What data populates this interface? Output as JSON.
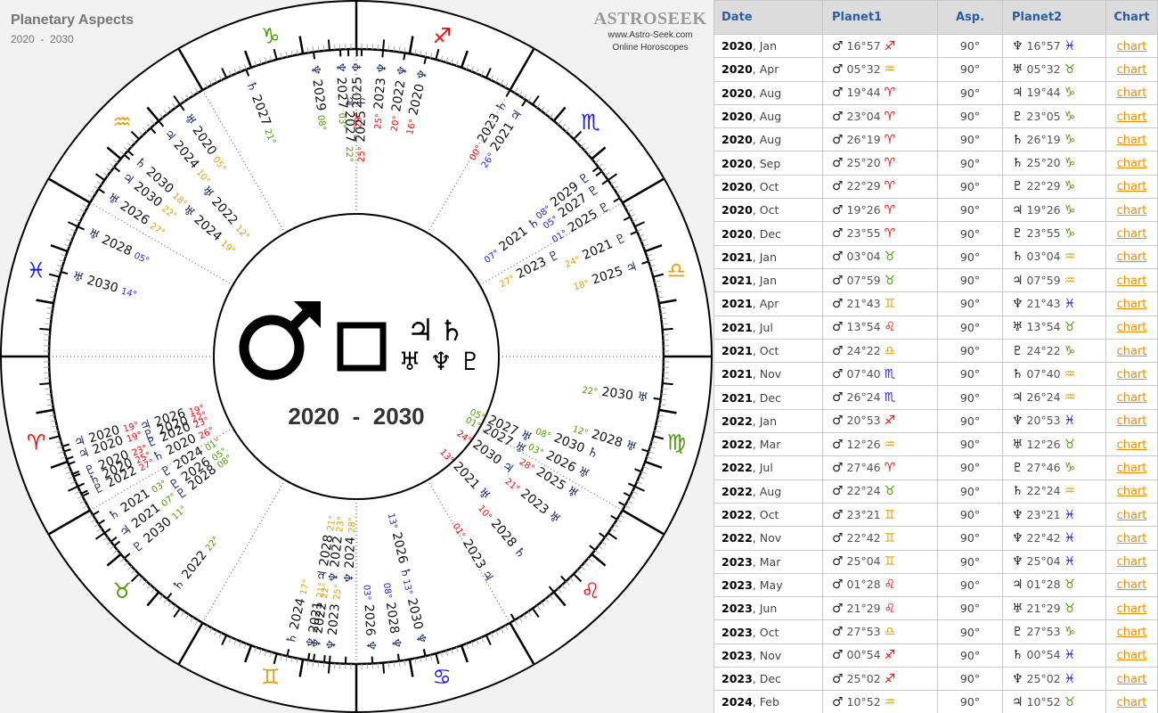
{
  "header": {
    "title": "Planetary Aspects",
    "subtitle": "2020  -  2030"
  },
  "logo": {
    "name": "ASTROSEEK",
    "url": "www.Astro-Seek.com",
    "tagline": "Online Horoscopes"
  },
  "wheel": {
    "center": {
      "planet1_icon": "mars-icon",
      "planet1_glyph": "♂",
      "aspect_icon": "square-aspect-icon",
      "aspect_glyph": "□",
      "planets2": [
        {
          "icon": "jupiter-icon",
          "glyph": "♃"
        },
        {
          "icon": "saturn-icon",
          "glyph": "♄"
        },
        {
          "icon": "uranus-icon",
          "glyph": "♅"
        },
        {
          "icon": "neptune-icon",
          "glyph": "♆"
        },
        {
          "icon": "pluto-icon",
          "glyph": "♇"
        }
      ],
      "years": "2020  -  2030"
    },
    "signs": [
      {
        "name": "Aries",
        "icon": "aries-icon",
        "glyph": "♈",
        "color": "#ff0000"
      },
      {
        "name": "Taurus",
        "icon": "taurus-icon",
        "glyph": "♉",
        "color": "#4c9a00"
      },
      {
        "name": "Gemini",
        "icon": "gemini-icon",
        "glyph": "♊",
        "color": "#e0a000"
      },
      {
        "name": "Cancer",
        "icon": "cancer-icon",
        "glyph": "♋",
        "color": "#1a1aff"
      },
      {
        "name": "Leo",
        "icon": "leo-icon",
        "glyph": "♌",
        "color": "#ff0000"
      },
      {
        "name": "Virgo",
        "icon": "virgo-icon",
        "glyph": "♍",
        "color": "#4c9a00"
      },
      {
        "name": "Libra",
        "icon": "libra-icon",
        "glyph": "♎",
        "color": "#e0a000"
      },
      {
        "name": "Scorpio",
        "icon": "scorpio-icon",
        "glyph": "♏",
        "color": "#1a1aff"
      },
      {
        "name": "Sagittarius",
        "icon": "sagittarius-icon",
        "glyph": "♐",
        "color": "#ff0000"
      },
      {
        "name": "Capricorn",
        "icon": "capricorn-icon",
        "glyph": "♑",
        "color": "#4c9a00"
      },
      {
        "name": "Aquarius",
        "icon": "aquarius-icon",
        "glyph": "♒",
        "color": "#e0a000"
      },
      {
        "name": "Pisces",
        "icon": "pisces-icon",
        "glyph": "♓",
        "color": "#1a1aff"
      }
    ],
    "markers": [
      {
        "planet": "♆",
        "year": "2020",
        "deg": "16°",
        "lon": 256.9,
        "row": 0
      },
      {
        "planet": "♆",
        "year": "2022",
        "deg": "20°",
        "lon": 260.9,
        "row": 0
      },
      {
        "planet": "♆",
        "year": "2023",
        "deg": "25°",
        "lon": 265.0,
        "row": 0
      },
      {
        "planet": "♆",
        "year": "2025",
        "deg": "29°",
        "lon": 269.9,
        "row": 0
      },
      {
        "planet": "♆",
        "year": "2027",
        "deg": "03°",
        "lon": 273.0,
        "row": 0
      },
      {
        "planet": "♆",
        "year": "2029",
        "deg": "08°",
        "lon": 278.0,
        "row": 0
      },
      {
        "planet": "♄",
        "year": "2027",
        "deg": "21°",
        "lon": 291.0,
        "row": 0
      },
      {
        "planet": "♄",
        "year": "2025",
        "deg": "25°",
        "lon": 269.0,
        "row": 1
      },
      {
        "planet": "♃",
        "year": "2027",
        "deg": "22°",
        "lon": 271.5,
        "row": 1
      },
      {
        "planet": "♄",
        "year": "2023",
        "deg": "00°",
        "lon": 240.0,
        "row": 0
      },
      {
        "planet": "♃",
        "year": "2021",
        "deg": "26°",
        "lon": 236.5,
        "row": 0
      },
      {
        "planet": "♇",
        "year": "2029",
        "deg": "08°",
        "lon": 218.0,
        "row": 0
      },
      {
        "planet": "♇",
        "year": "2027",
        "deg": "05°",
        "lon": 215.0,
        "row": 0
      },
      {
        "planet": "♇",
        "year": "2025",
        "deg": "01°",
        "lon": 211.0,
        "row": 0
      },
      {
        "planet": "♄",
        "year": "2021",
        "deg": "07°",
        "lon": 217.0,
        "row": 2
      },
      {
        "planet": "♇",
        "year": "2023",
        "deg": "27°",
        "lon": 207.0,
        "row": 2
      },
      {
        "planet": "♇",
        "year": "2021",
        "deg": "24°",
        "lon": 204.0,
        "row": 0
      },
      {
        "planet": "♃",
        "year": "2025",
        "deg": "18°",
        "lon": 198.0,
        "row": 0
      },
      {
        "planet": "♅",
        "year": "2030",
        "deg": "22°",
        "lon": 172.0,
        "row": 0
      },
      {
        "planet": "♅",
        "year": "2028",
        "deg": "12°",
        "lon": 162.0,
        "row": 0
      },
      {
        "planet": "♄",
        "year": "2030",
        "deg": "08°",
        "lon": 158.0,
        "row": 1
      },
      {
        "planet": "♅",
        "year": "2026",
        "deg": "03°",
        "lon": 153.0,
        "row": 1
      },
      {
        "planet": "♅",
        "year": "2025",
        "deg": "28°",
        "lon": 148.0,
        "row": 1
      },
      {
        "planet": "♅",
        "year": "2027",
        "deg": "05°",
        "lon": 155.0,
        "row": 3
      },
      {
        "planet": "♅",
        "year": "2027",
        "deg": "01°",
        "lon": 151.0,
        "row": 3
      },
      {
        "planet": "♃",
        "year": "2030",
        "deg": "24°",
        "lon": 144.0,
        "row": 3
      },
      {
        "planet": "♅",
        "year": "2023",
        "deg": "21°",
        "lon": 141.0,
        "row": 1
      },
      {
        "planet": "♅",
        "year": "2021",
        "deg": "13°",
        "lon": 133.0,
        "row": 3
      },
      {
        "planet": "♄",
        "year": "2028",
        "deg": "10°",
        "lon": 130.0,
        "row": 1
      },
      {
        "planet": "♃",
        "year": "2023",
        "deg": "01°",
        "lon": 121.0,
        "row": 1
      },
      {
        "planet": "♆",
        "year": "2030",
        "deg": "13°",
        "lon": 103.0,
        "row": 0
      },
      {
        "planet": "♆",
        "year": "2028",
        "deg": "08°",
        "lon": 98.0,
        "row": 0
      },
      {
        "planet": "♆",
        "year": "2026",
        "deg": "03°",
        "lon": 93.0,
        "row": 0
      },
      {
        "planet": "♄",
        "year": "2026",
        "deg": "13°",
        "lon": 103.0,
        "row": 2
      },
      {
        "planet": "♆",
        "year": "2023",
        "deg": "25°",
        "lon": 85.0,
        "row": 0
      },
      {
        "planet": "♆",
        "year": "2022",
        "deg": "22°",
        "lon": 82.0,
        "row": 0
      },
      {
        "planet": "♆",
        "year": "2021",
        "deg": "21°",
        "lon": 81.0,
        "row": 0
      },
      {
        "planet": "♄",
        "year": "2024",
        "deg": "17°",
        "lon": 77.0,
        "row": 0
      },
      {
        "planet": "♆",
        "year": "2024",
        "deg": "28°",
        "lon": 88.0,
        "row": 2
      },
      {
        "planet": "♆",
        "year": "2022",
        "deg": "23°",
        "lon": 84.0,
        "row": 2
      },
      {
        "planet": "♃",
        "year": "2028",
        "deg": "21°",
        "lon": 81.0,
        "row": 2
      },
      {
        "planet": "♄",
        "year": "2022",
        "deg": "22°",
        "lon": 52.0,
        "row": 0
      },
      {
        "planet": "♇",
        "year": "2030",
        "deg": "11°",
        "lon": 41.0,
        "row": 0
      },
      {
        "planet": "♃",
        "year": "2021",
        "deg": "07°",
        "lon": 37.0,
        "row": 0
      },
      {
        "planet": "♄",
        "year": "2021",
        "deg": "03°",
        "lon": 33.0,
        "row": 0
      },
      {
        "planet": "♇",
        "year": "2022",
        "deg": "27°",
        "lon": 27.0,
        "row": 0
      },
      {
        "planet": "♄",
        "year": "2020",
        "deg": "25°",
        "lon": 25.0,
        "row": 0
      },
      {
        "planet": "♇",
        "year": "2020",
        "deg": "23°",
        "lon": 23.0,
        "row": 0
      },
      {
        "planet": "♃",
        "year": "2020",
        "deg": "19°",
        "lon": 19.5,
        "row": 0
      },
      {
        "planet": "♃",
        "year": "2020",
        "deg": "19°",
        "lon": 17.0,
        "row": 0
      },
      {
        "planet": "♇",
        "year": "2028",
        "deg": "08°",
        "lon": 38.0,
        "row": 2
      },
      {
        "planet": "♇",
        "year": "2026",
        "deg": "05°",
        "lon": 35.0,
        "row": 2
      },
      {
        "planet": "♇",
        "year": "2024",
        "deg": "01°",
        "lon": 31.0,
        "row": 2
      },
      {
        "planet": "♄",
        "year": "2020",
        "deg": "26°",
        "lon": 26.5,
        "row": 2
      },
      {
        "planet": "♇",
        "year": "2020",
        "deg": "23°",
        "lon": 22.5,
        "row": 2
      },
      {
        "planet": "♇",
        "year": "2020",
        "deg": "22°",
        "lon": 20.5,
        "row": 2
      },
      {
        "planet": "♃",
        "year": "2026",
        "deg": "19°",
        "lon": 18.0,
        "row": 2
      },
      {
        "planet": "♅",
        "year": "2030",
        "deg": "14°",
        "lon": 344.0,
        "row": 0
      },
      {
        "planet": "♅",
        "year": "2028",
        "deg": "05°",
        "lon": 335.0,
        "row": 0
      },
      {
        "planet": "♅",
        "year": "2026",
        "deg": "27°",
        "lon": 327.0,
        "row": 0
      },
      {
        "planet": "♃",
        "year": "2030",
        "deg": "22°",
        "lon": 322.0,
        "row": 0
      },
      {
        "planet": "♄",
        "year": "2030",
        "deg": "18°",
        "lon": 318.0,
        "row": 0
      },
      {
        "planet": "♃",
        "year": "2024",
        "deg": "10°",
        "lon": 310.0,
        "row": 0
      },
      {
        "planet": "♅",
        "year": "2020",
        "deg": "05°",
        "lon": 305.0,
        "row": 0
      },
      {
        "planet": "♅",
        "year": "2024",
        "deg": "19°",
        "lon": 319.0,
        "row": 2
      },
      {
        "planet": "♅",
        "year": "2022",
        "deg": "12°",
        "lon": 312.0,
        "row": 2
      }
    ]
  },
  "table": {
    "columns": [
      "Date",
      "Planet1",
      "Asp.",
      "Planet2",
      "Chart"
    ],
    "rows": [
      {
        "year": "2020",
        "month": ", Jan",
        "p1": "♂",
        "p1_deg": "16°57",
        "p1_sign": "♐",
        "p1_color": "#ff0000",
        "asp": "90°",
        "p2": "♆",
        "p2_deg": "16°57",
        "p2_sign": "♓",
        "p2_color": "#1a1aff",
        "link": "chart"
      },
      {
        "year": "2020",
        "month": ", Apr",
        "p1": "♂",
        "p1_deg": "05°32",
        "p1_sign": "♒",
        "p1_color": "#e0a000",
        "asp": "90°",
        "p2": "♅",
        "p2_deg": "05°32",
        "p2_sign": "♉",
        "p2_color": "#4c9a00",
        "link": "chart"
      },
      {
        "year": "2020",
        "month": ", Aug",
        "p1": "♂",
        "p1_deg": "19°44",
        "p1_sign": "♈",
        "p1_color": "#ff0000",
        "asp": "90°",
        "p2": "♃",
        "p2_deg": "19°44",
        "p2_sign": "♑",
        "p2_color": "#4c9a00",
        "link": "chart"
      },
      {
        "year": "2020",
        "month": ", Aug",
        "p1": "♂",
        "p1_deg": "23°04",
        "p1_sign": "♈",
        "p1_color": "#ff0000",
        "asp": "90°",
        "p2": "♇",
        "p2_deg": "23°05",
        "p2_sign": "♑",
        "p2_color": "#4c9a00",
        "link": "chart"
      },
      {
        "year": "2020",
        "month": ", Aug",
        "p1": "♂",
        "p1_deg": "26°19",
        "p1_sign": "♈",
        "p1_color": "#ff0000",
        "asp": "90°",
        "p2": "♄",
        "p2_deg": "26°19",
        "p2_sign": "♑",
        "p2_color": "#4c9a00",
        "link": "chart"
      },
      {
        "year": "2020",
        "month": ", Sep",
        "p1": "♂",
        "p1_deg": "25°20",
        "p1_sign": "♈",
        "p1_color": "#ff0000",
        "asp": "90°",
        "p2": "♄",
        "p2_deg": "25°20",
        "p2_sign": "♑",
        "p2_color": "#4c9a00",
        "link": "chart"
      },
      {
        "year": "2020",
        "month": ", Oct",
        "p1": "♂",
        "p1_deg": "22°29",
        "p1_sign": "♈",
        "p1_color": "#ff0000",
        "asp": "90°",
        "p2": "♇",
        "p2_deg": "22°29",
        "p2_sign": "♑",
        "p2_color": "#4c9a00",
        "link": "chart"
      },
      {
        "year": "2020",
        "month": ", Oct",
        "p1": "♂",
        "p1_deg": "19°26",
        "p1_sign": "♈",
        "p1_color": "#ff0000",
        "asp": "90°",
        "p2": "♃",
        "p2_deg": "19°26",
        "p2_sign": "♑",
        "p2_color": "#4c9a00",
        "link": "chart"
      },
      {
        "year": "2020",
        "month": ", Dec",
        "p1": "♂",
        "p1_deg": "23°55",
        "p1_sign": "♈",
        "p1_color": "#ff0000",
        "asp": "90°",
        "p2": "♇",
        "p2_deg": "23°55",
        "p2_sign": "♑",
        "p2_color": "#4c9a00",
        "link": "chart"
      },
      {
        "year": "2021",
        "month": ", Jan",
        "p1": "♂",
        "p1_deg": "03°04",
        "p1_sign": "♉",
        "p1_color": "#4c9a00",
        "asp": "90°",
        "p2": "♄",
        "p2_deg": "03°04",
        "p2_sign": "♒",
        "p2_color": "#e0a000",
        "link": "chart"
      },
      {
        "year": "2021",
        "month": ", Jan",
        "p1": "♂",
        "p1_deg": "07°59",
        "p1_sign": "♉",
        "p1_color": "#4c9a00",
        "asp": "90°",
        "p2": "♃",
        "p2_deg": "07°59",
        "p2_sign": "♒",
        "p2_color": "#e0a000",
        "link": "chart"
      },
      {
        "year": "2021",
        "month": ", Apr",
        "p1": "♂",
        "p1_deg": "21°43",
        "p1_sign": "♊",
        "p1_color": "#e0a000",
        "asp": "90°",
        "p2": "♆",
        "p2_deg": "21°43",
        "p2_sign": "♓",
        "p2_color": "#1a1aff",
        "link": "chart"
      },
      {
        "year": "2021",
        "month": ", Jul",
        "p1": "♂",
        "p1_deg": "13°54",
        "p1_sign": "♌",
        "p1_color": "#ff0000",
        "asp": "90°",
        "p2": "♅",
        "p2_deg": "13°54",
        "p2_sign": "♉",
        "p2_color": "#4c9a00",
        "link": "chart"
      },
      {
        "year": "2021",
        "month": ", Oct",
        "p1": "♂",
        "p1_deg": "24°22",
        "p1_sign": "♎",
        "p1_color": "#e0a000",
        "asp": "90°",
        "p2": "♇",
        "p2_deg": "24°22",
        "p2_sign": "♑",
        "p2_color": "#4c9a00",
        "link": "chart"
      },
      {
        "year": "2021",
        "month": ", Nov",
        "p1": "♂",
        "p1_deg": "07°40",
        "p1_sign": "♏",
        "p1_color": "#1a1aff",
        "asp": "90°",
        "p2": "♄",
        "p2_deg": "07°40",
        "p2_sign": "♒",
        "p2_color": "#e0a000",
        "link": "chart"
      },
      {
        "year": "2021",
        "month": ", Dec",
        "p1": "♂",
        "p1_deg": "26°24",
        "p1_sign": "♏",
        "p1_color": "#1a1aff",
        "asp": "90°",
        "p2": "♃",
        "p2_deg": "26°24",
        "p2_sign": "♒",
        "p2_color": "#e0a000",
        "link": "chart"
      },
      {
        "year": "2022",
        "month": ", Jan",
        "p1": "♂",
        "p1_deg": "20°53",
        "p1_sign": "♐",
        "p1_color": "#ff0000",
        "asp": "90°",
        "p2": "♆",
        "p2_deg": "20°53",
        "p2_sign": "♓",
        "p2_color": "#1a1aff",
        "link": "chart"
      },
      {
        "year": "2022",
        "month": ", Mar",
        "p1": "♂",
        "p1_deg": "12°26",
        "p1_sign": "♒",
        "p1_color": "#e0a000",
        "asp": "90°",
        "p2": "♅",
        "p2_deg": "12°26",
        "p2_sign": "♉",
        "p2_color": "#4c9a00",
        "link": "chart"
      },
      {
        "year": "2022",
        "month": ", Jul",
        "p1": "♂",
        "p1_deg": "27°46",
        "p1_sign": "♈",
        "p1_color": "#ff0000",
        "asp": "90°",
        "p2": "♇",
        "p2_deg": "27°46",
        "p2_sign": "♑",
        "p2_color": "#4c9a00",
        "link": "chart"
      },
      {
        "year": "2022",
        "month": ", Aug",
        "p1": "♂",
        "p1_deg": "22°24",
        "p1_sign": "♉",
        "p1_color": "#4c9a00",
        "asp": "90°",
        "p2": "♄",
        "p2_deg": "22°24",
        "p2_sign": "♒",
        "p2_color": "#e0a000",
        "link": "chart"
      },
      {
        "year": "2022",
        "month": ", Oct",
        "p1": "♂",
        "p1_deg": "23°21",
        "p1_sign": "♊",
        "p1_color": "#e0a000",
        "asp": "90°",
        "p2": "♆",
        "p2_deg": "23°21",
        "p2_sign": "♓",
        "p2_color": "#1a1aff",
        "link": "chart"
      },
      {
        "year": "2022",
        "month": ", Nov",
        "p1": "♂",
        "p1_deg": "22°42",
        "p1_sign": "♊",
        "p1_color": "#e0a000",
        "asp": "90°",
        "p2": "♆",
        "p2_deg": "22°42",
        "p2_sign": "♓",
        "p2_color": "#1a1aff",
        "link": "chart"
      },
      {
        "year": "2023",
        "month": ", Mar",
        "p1": "♂",
        "p1_deg": "25°04",
        "p1_sign": "♊",
        "p1_color": "#e0a000",
        "asp": "90°",
        "p2": "♆",
        "p2_deg": "25°04",
        "p2_sign": "♓",
        "p2_color": "#1a1aff",
        "link": "chart"
      },
      {
        "year": "2023",
        "month": ", May",
        "p1": "♂",
        "p1_deg": "01°28",
        "p1_sign": "♌",
        "p1_color": "#ff0000",
        "asp": "90°",
        "p2": "♃",
        "p2_deg": "01°28",
        "p2_sign": "♉",
        "p2_color": "#4c9a00",
        "link": "chart"
      },
      {
        "year": "2023",
        "month": ", Jun",
        "p1": "♂",
        "p1_deg": "21°29",
        "p1_sign": "♌",
        "p1_color": "#ff0000",
        "asp": "90°",
        "p2": "♅",
        "p2_deg": "21°29",
        "p2_sign": "♉",
        "p2_color": "#4c9a00",
        "link": "chart"
      },
      {
        "year": "2023",
        "month": ", Oct",
        "p1": "♂",
        "p1_deg": "27°53",
        "p1_sign": "♎",
        "p1_color": "#e0a000",
        "asp": "90°",
        "p2": "♇",
        "p2_deg": "27°53",
        "p2_sign": "♑",
        "p2_color": "#4c9a00",
        "link": "chart"
      },
      {
        "year": "2023",
        "month": ", Nov",
        "p1": "♂",
        "p1_deg": "00°54",
        "p1_sign": "♐",
        "p1_color": "#ff0000",
        "asp": "90°",
        "p2": "♄",
        "p2_deg": "00°54",
        "p2_sign": "♓",
        "p2_color": "#1a1aff",
        "link": "chart"
      },
      {
        "year": "2023",
        "month": ", Dec",
        "p1": "♂",
        "p1_deg": "25°02",
        "p1_sign": "♐",
        "p1_color": "#ff0000",
        "asp": "90°",
        "p2": "♆",
        "p2_deg": "25°02",
        "p2_sign": "♓",
        "p2_color": "#1a1aff",
        "link": "chart"
      },
      {
        "year": "2024",
        "month": ", Feb",
        "p1": "♂",
        "p1_deg": "10°52",
        "p1_sign": "♒",
        "p1_color": "#e0a000",
        "asp": "90°",
        "p2": "♃",
        "p2_deg": "10°52",
        "p2_sign": "♉",
        "p2_color": "#4c9a00",
        "link": "chart"
      }
    ]
  }
}
